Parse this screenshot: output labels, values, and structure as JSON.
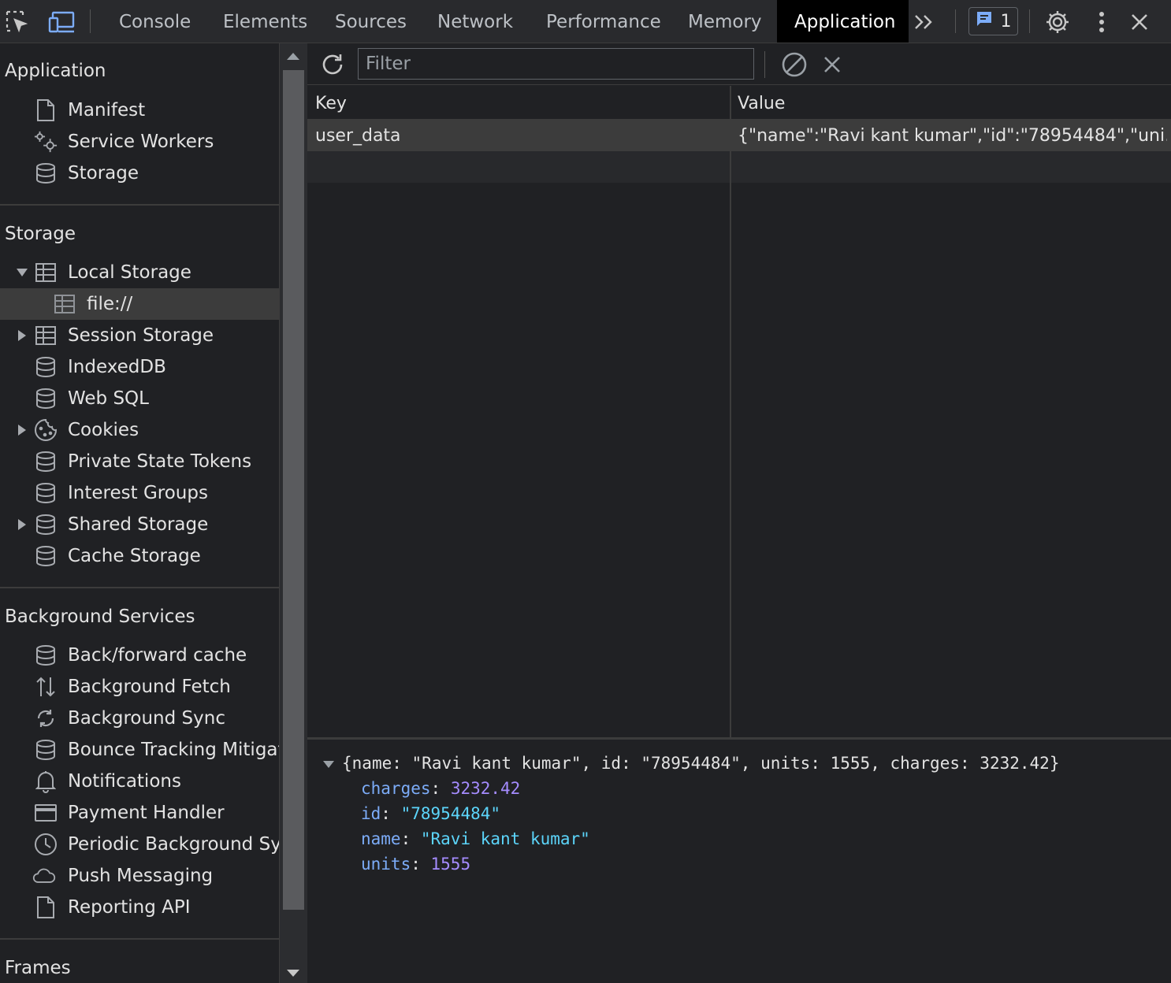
{
  "toolbar": {
    "tabs": [
      "Console",
      "Elements",
      "Sources",
      "Network",
      "Performance",
      "Memory",
      "Application"
    ],
    "active_tab": "Application",
    "issues_count": "1"
  },
  "sidebar": {
    "application": {
      "title": "Application",
      "items": [
        "Manifest",
        "Service Workers",
        "Storage"
      ]
    },
    "storage": {
      "title": "Storage",
      "items": [
        "Local Storage",
        "file://",
        "Session Storage",
        "IndexedDB",
        "Web SQL",
        "Cookies",
        "Private State Tokens",
        "Interest Groups",
        "Shared Storage",
        "Cache Storage"
      ]
    },
    "background": {
      "title": "Background Services",
      "items": [
        "Back/forward cache",
        "Background Fetch",
        "Background Sync",
        "Bounce Tracking Mitigations",
        "Notifications",
        "Payment Handler",
        "Periodic Background Sync",
        "Push Messaging",
        "Reporting API"
      ]
    },
    "frames": {
      "title": "Frames"
    }
  },
  "filter": {
    "placeholder": "Filter",
    "value": ""
  },
  "grid": {
    "columns": [
      "Key",
      "Value"
    ],
    "rows": [
      {
        "key": "user_data",
        "value": "{\"name\":\"Ravi kant kumar\",\"id\":\"78954484\",\"uni…"
      }
    ]
  },
  "preview": {
    "summary": {
      "open": "{",
      "name_key": "name",
      "name_val": "\"Ravi kant kumar\"",
      "id_key": "id",
      "id_val": "\"78954484\"",
      "units_key": "units",
      "units_val": "1555",
      "charges_key": "charges",
      "charges_val": "3232.42",
      "close": "}"
    },
    "props": [
      {
        "key": "charges",
        "value": "3232.42",
        "type": "number"
      },
      {
        "key": "id",
        "value": "\"78954484\"",
        "type": "string"
      },
      {
        "key": "name",
        "value": "\"Ravi kant kumar\"",
        "type": "string"
      },
      {
        "key": "units",
        "value": "1555",
        "type": "number"
      }
    ]
  }
}
